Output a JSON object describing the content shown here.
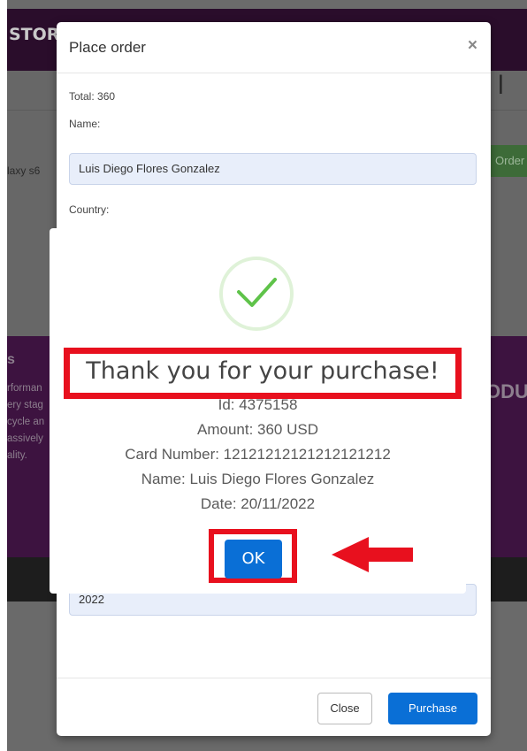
{
  "background": {
    "brand": "STORE",
    "galaxy": "laxy s6",
    "order_button": "Order",
    "big_letter": "l",
    "heading_fragment": "ODU",
    "side_letter": "s",
    "side_lines": [
      "rforman",
      "ery stag",
      "cycle an",
      "assively",
      "ality."
    ]
  },
  "modal": {
    "title": "Place order",
    "close_glyph": "×",
    "total": "Total: 360",
    "name_label": "Name:",
    "name_value": "Luis Diego Flores Gonzalez",
    "country_label": "Country:",
    "year_value": "2022",
    "close_label": "Close",
    "purchase_label": "Purchase"
  },
  "alert": {
    "title": "Thank you for your purchase!",
    "lines": [
      "Id: 4375158",
      "Amount: 360 USD",
      "Card Number: 12121212121212121212",
      "Name: Luis Diego Flores Gonzalez",
      "Date: 20/11/2022"
    ],
    "ok_label": "OK"
  },
  "colors": {
    "highlight": "#e8101e",
    "primary": "#0a6fd6",
    "success": "#5fc34a"
  },
  "icons": {
    "close": "close-icon",
    "success": "success-check-icon",
    "arrow": "arrow-left-icon"
  }
}
